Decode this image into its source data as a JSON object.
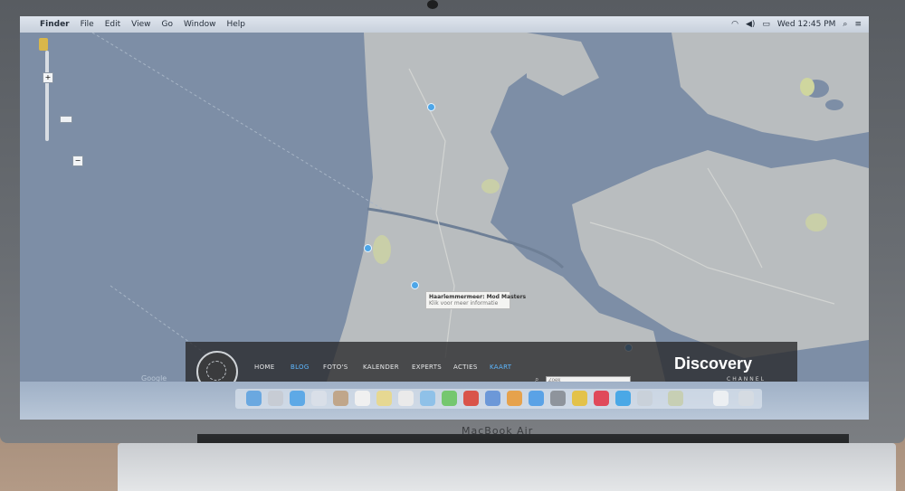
{
  "menubar": {
    "app_name": "Finder",
    "menus": [
      "File",
      "Edit",
      "View",
      "Go",
      "Window",
      "Help"
    ],
    "clock": "Wed 12:45 PM"
  },
  "map": {
    "zoom_plus": "+",
    "zoom_minus": "−",
    "tooltip": {
      "title": "Haarlemmermeer: Mod Masters",
      "subtitle": "Klik voor meer informatie"
    },
    "attribution": "Google"
  },
  "site": {
    "nav": [
      "HOME",
      "BLOG",
      "FOTO'S",
      "KALENDER",
      "EXPERTS",
      "ACTIES",
      "KAART"
    ],
    "active_nav": [
      "BLOG",
      "KAART"
    ],
    "search_placeholder": "Zoek",
    "brand": "Discovery",
    "brand_sub": "CHANNEL"
  },
  "laptop": {
    "model_label": "MacBook Air"
  },
  "colors": {
    "water": "#7d8ea6",
    "land": "#b9bdbf",
    "marker": "#4da6e8",
    "nav_active": "#5db7ff"
  }
}
